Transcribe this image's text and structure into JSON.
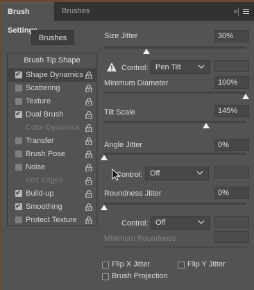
{
  "tabs": {
    "active": "Brush Settings",
    "inactive": "Brushes"
  },
  "brushes_button": "Brushes",
  "tip_list": {
    "header": "Brush Tip Shape",
    "items": [
      {
        "label": "Shape Dynamics",
        "checked": true,
        "lock": true,
        "active": true
      },
      {
        "label": "Scattering",
        "checked": false,
        "lock": true
      },
      {
        "label": "Texture",
        "checked": false,
        "lock": true
      },
      {
        "label": "Dual Brush",
        "checked": true,
        "lock": true
      },
      {
        "label": "Color Dynamics",
        "checked": false,
        "lock": true,
        "disabled": true
      },
      {
        "label": "Transfer",
        "checked": false,
        "lock": true
      },
      {
        "label": "Brush Pose",
        "checked": false,
        "lock": true
      },
      {
        "label": "Noise",
        "checked": false,
        "lock": true
      },
      {
        "label": "Wet Edges",
        "checked": false,
        "lock": true,
        "disabled": true
      },
      {
        "label": "Build-up",
        "checked": true,
        "lock": true
      },
      {
        "label": "Smoothing",
        "checked": true,
        "lock": true
      },
      {
        "label": "Protect Texture",
        "checked": false,
        "lock": true
      }
    ]
  },
  "settings": {
    "size_jitter": {
      "label": "Size Jitter",
      "value": "30%",
      "level": 0.3
    },
    "control1": {
      "label": "Control:",
      "value": "Pen Tilt"
    },
    "minimum_diameter": {
      "label": "Minimum Diameter",
      "value": "100%",
      "level": 1.0
    },
    "tilt_scale": {
      "label": "Tilt Scale",
      "value": "145%",
      "level": 0.72
    },
    "angle_jitter": {
      "label": "Angle Jitter",
      "value": "0%",
      "level": 0.0
    },
    "control2": {
      "label": "Control:",
      "value": "Off"
    },
    "roundness_jitter": {
      "label": "Roundness Jitter",
      "value": "0%",
      "level": 0.0
    },
    "control3": {
      "label": "Control:",
      "value": "Off"
    },
    "minimum_roundness": {
      "label": "Minimum Roundness"
    }
  },
  "bottom_options": {
    "flip_x": "Flip X Jitter",
    "flip_y": "Flip Y Jitter",
    "brush_projection": "Brush Projection"
  },
  "colors": {
    "panel": "#535353",
    "tabbar": "#323232",
    "field": "#474747",
    "thumb": "#f0f0f0"
  }
}
